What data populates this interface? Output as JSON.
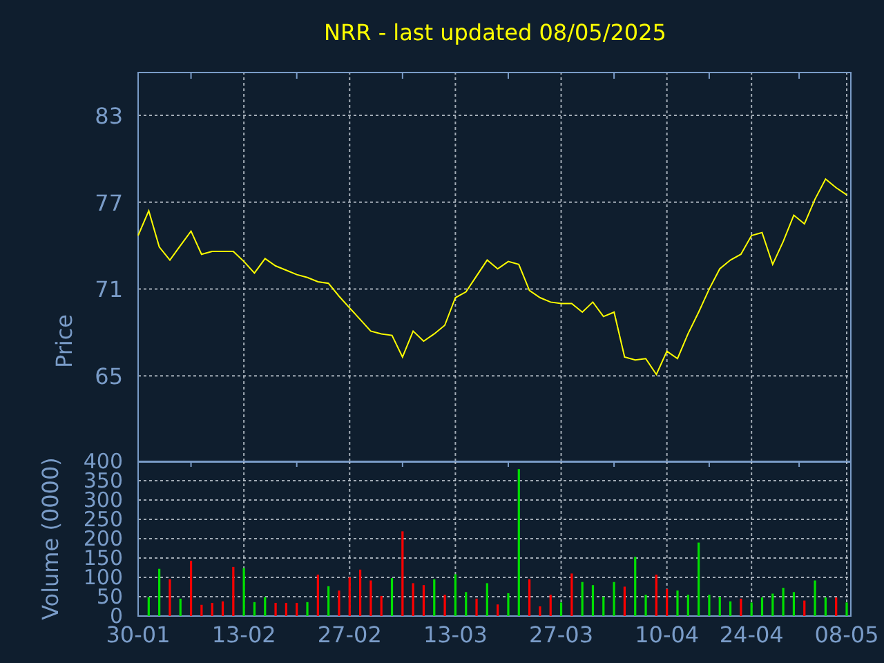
{
  "title": "NRR - last updated 08/05/2025",
  "price_panel": {
    "chart_data": {
      "type": "line",
      "ylabel": "Price",
      "series": [
        {
          "color": "#ffff00",
          "values": [
            74.7,
            76.4,
            73.9,
            73.0,
            74.0,
            75.0,
            73.4,
            73.6,
            73.6,
            73.6,
            72.9,
            72.1,
            73.1,
            72.6,
            72.3,
            72.0,
            71.8,
            71.5,
            71.4,
            70.5,
            69.7,
            68.9,
            68.1,
            67.9,
            67.8,
            66.3,
            68.1,
            67.4,
            67.9,
            68.5,
            70.4,
            70.8,
            71.9,
            73.0,
            72.4,
            72.9,
            72.7,
            70.9,
            70.4,
            70.1,
            70.0,
            70.0,
            69.4,
            70.1,
            69.1,
            69.4,
            66.3,
            66.1,
            66.2,
            65.1,
            66.7,
            66.2,
            67.9,
            69.4,
            71.0,
            72.4,
            73.0,
            73.4,
            74.7,
            74.9,
            72.7,
            74.3,
            76.1,
            75.5,
            77.2,
            78.6,
            78.0,
            77.5
          ]
        }
      ],
      "categories": [
        null,
        null,
        null,
        null,
        null,
        null,
        null,
        null,
        null,
        null,
        null,
        null,
        null,
        null,
        null,
        null,
        null,
        null,
        null,
        null,
        null,
        null,
        null,
        null,
        null,
        null,
        null,
        null,
        null,
        null,
        null,
        null,
        null,
        null,
        null,
        null,
        null,
        null,
        null,
        null,
        null,
        null,
        null,
        null,
        null,
        null,
        null,
        null,
        null,
        null,
        null,
        null,
        null,
        null,
        null,
        null,
        null,
        null,
        null,
        null,
        null,
        null,
        null,
        null,
        null,
        null,
        null,
        null
      ],
      "grid": true,
      "ylim": [
        59.1,
        86
      ],
      "yticks": [
        65,
        71,
        77,
        83
      ]
    }
  },
  "volume_panel": {
    "chart_data": {
      "type": "bar",
      "ylabel": "Volume (0000)",
      "series": [
        {
          "color": "#00e000",
          "values": [
            null,
            49,
            122,
            null,
            45,
            null,
            null,
            null,
            null,
            null,
            124,
            36,
            49,
            null,
            null,
            null,
            36,
            null,
            77,
            null,
            null,
            null,
            null,
            null,
            98,
            null,
            null,
            null,
            95,
            null,
            108,
            62,
            null,
            85,
            null,
            59,
            380,
            null,
            null,
            null,
            35,
            null,
            88,
            80,
            50,
            88,
            null,
            153,
            55,
            null,
            null,
            66,
            55,
            190,
            55,
            50,
            38,
            null,
            35,
            48,
            58,
            73,
            62,
            null,
            92,
            48,
            null,
            35
          ]
        },
        {
          "color": "#ff0000",
          "values": [
            null,
            null,
            null,
            95,
            null,
            143,
            29,
            34,
            38,
            127,
            null,
            null,
            null,
            34,
            34,
            34,
            null,
            107,
            null,
            66,
            100,
            120,
            92,
            52,
            null,
            219,
            85,
            80,
            null,
            55,
            null,
            null,
            45,
            null,
            30,
            null,
            null,
            95,
            25,
            55,
            null,
            110,
            null,
            null,
            null,
            null,
            76,
            null,
            null,
            107,
            70,
            null,
            null,
            null,
            null,
            null,
            null,
            45,
            null,
            null,
            null,
            null,
            null,
            40,
            null,
            null,
            48,
            null
          ]
        }
      ],
      "categories": [
        "30-01",
        null,
        null,
        null,
        null,
        null,
        null,
        null,
        null,
        null,
        "13-02",
        null,
        null,
        null,
        null,
        null,
        null,
        null,
        null,
        null,
        "27-02",
        null,
        null,
        null,
        null,
        null,
        null,
        null,
        null,
        null,
        "13-03",
        null,
        null,
        null,
        null,
        null,
        null,
        null,
        null,
        null,
        "27-03",
        null,
        null,
        null,
        null,
        null,
        null,
        null,
        null,
        null,
        "10-04",
        null,
        null,
        null,
        null,
        null,
        null,
        null,
        "24-04",
        null,
        null,
        null,
        null,
        null,
        null,
        null,
        null,
        "08-05"
      ],
      "grid": true,
      "ylim": [
        0,
        400
      ],
      "yticks": [
        0,
        50,
        100,
        150,
        200,
        250,
        300,
        350,
        400
      ]
    }
  }
}
